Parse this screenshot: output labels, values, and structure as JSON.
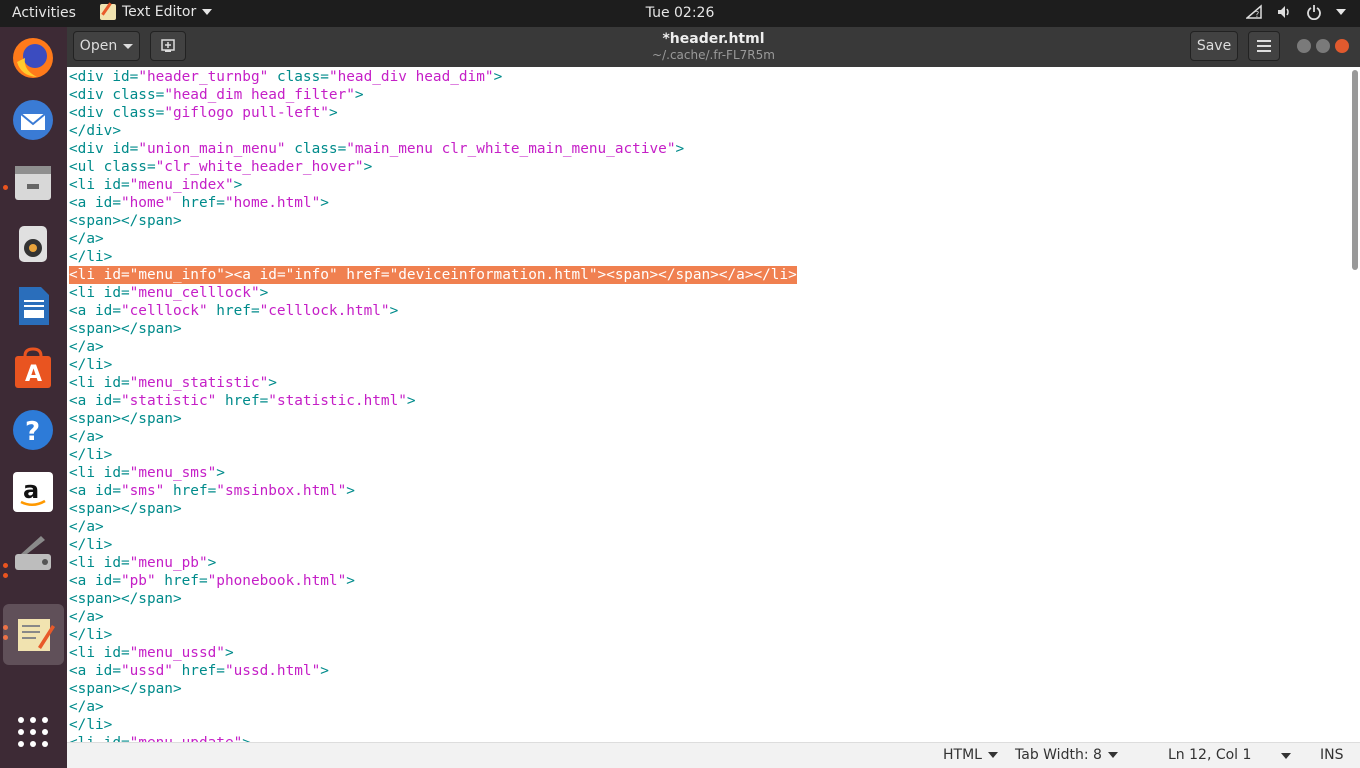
{
  "topbar": {
    "activities": "Activities",
    "app_name": "Text Editor",
    "clock": "Tue 02:26",
    "tray_icons": [
      "network-question-icon",
      "volume-icon",
      "power-icon"
    ]
  },
  "dock": {
    "apps": [
      {
        "name": "firefox",
        "color": "#ff7a1a"
      },
      {
        "name": "thunderbird",
        "color": "#3a7bd5"
      },
      {
        "name": "files",
        "color": "#d8d8d8"
      },
      {
        "name": "rhythmbox",
        "color": "#e0e0e0"
      },
      {
        "name": "libreoffice-writer",
        "color": "#2a6ebb"
      },
      {
        "name": "ubuntu-software",
        "color": "#e95420"
      },
      {
        "name": "help",
        "color": "#2d7bd8"
      },
      {
        "name": "amazon",
        "color": "#ffffff"
      },
      {
        "name": "scanner",
        "color": "#bdbdbd"
      },
      {
        "name": "text-editor",
        "color": "#f1e3b0"
      }
    ]
  },
  "header": {
    "open_label": "Open",
    "title": "*header.html",
    "subtitle": "~/.cache/.fr-FL7R5m",
    "save_label": "Save"
  },
  "editor": {
    "lines": [
      [
        [
          "tag",
          "<div id="
        ],
        [
          "str",
          "\"header_turnbg\""
        ],
        [
          "tag",
          " class="
        ],
        [
          "str",
          "\"head_div head_dim\""
        ],
        [
          "tag",
          ">"
        ]
      ],
      [
        [
          "tag",
          "<div class="
        ],
        [
          "str",
          "\"head_dim head_filter\""
        ],
        [
          "tag",
          ">"
        ]
      ],
      [
        [
          "tag",
          "<div class="
        ],
        [
          "str",
          "\"giflogo pull-left\""
        ],
        [
          "tag",
          ">"
        ]
      ],
      [
        [
          "tag",
          "</div>"
        ]
      ],
      [
        [
          "tag",
          "<div id="
        ],
        [
          "str",
          "\"union_main_menu\""
        ],
        [
          "tag",
          " class="
        ],
        [
          "str",
          "\"main_menu clr_white_main_menu_active\""
        ],
        [
          "tag",
          ">"
        ]
      ],
      [
        [
          "tag",
          "<ul class="
        ],
        [
          "str",
          "\"clr_white_header_hover\""
        ],
        [
          "tag",
          ">"
        ]
      ],
      [
        [
          "tag",
          "<li id="
        ],
        [
          "str",
          "\"menu_index\""
        ],
        [
          "tag",
          ">"
        ]
      ],
      [
        [
          "tag",
          "<a id="
        ],
        [
          "str",
          "\"home\""
        ],
        [
          "tag",
          " href="
        ],
        [
          "str",
          "\"home.html\""
        ],
        [
          "tag",
          ">"
        ]
      ],
      [
        [
          "tag",
          "<span></span>"
        ]
      ],
      [
        [
          "tag",
          "</a>"
        ]
      ],
      [
        [
          "tag",
          "</li>"
        ]
      ],
      [
        [
          "tag",
          "<li id="
        ],
        [
          "str",
          "\"menu_info\""
        ],
        [
          "tag",
          "><a id="
        ],
        [
          "str",
          "\"info\""
        ],
        [
          "tag",
          " href="
        ],
        [
          "str",
          "\"deviceinformation.html\""
        ],
        [
          "tag",
          "><span></span></a></li>"
        ]
      ],
      [
        [
          "tag",
          "<li id="
        ],
        [
          "str",
          "\"menu_celllock\""
        ],
        [
          "tag",
          ">"
        ]
      ],
      [
        [
          "tag",
          "<a id="
        ],
        [
          "str",
          "\"celllock\""
        ],
        [
          "tag",
          " href="
        ],
        [
          "str",
          "\"celllock.html\""
        ],
        [
          "tag",
          ">"
        ]
      ],
      [
        [
          "tag",
          "<span></span>"
        ]
      ],
      [
        [
          "tag",
          "</a>"
        ]
      ],
      [
        [
          "tag",
          "</li>"
        ]
      ],
      [
        [
          "tag",
          "<li id="
        ],
        [
          "str",
          "\"menu_statistic\""
        ],
        [
          "tag",
          ">"
        ]
      ],
      [
        [
          "tag",
          "<a id="
        ],
        [
          "str",
          "\"statistic\""
        ],
        [
          "tag",
          " href="
        ],
        [
          "str",
          "\"statistic.html\""
        ],
        [
          "tag",
          ">"
        ]
      ],
      [
        [
          "tag",
          "<span></span>"
        ]
      ],
      [
        [
          "tag",
          "</a>"
        ]
      ],
      [
        [
          "tag",
          "</li>"
        ]
      ],
      [
        [
          "tag",
          "<li id="
        ],
        [
          "str",
          "\"menu_sms\""
        ],
        [
          "tag",
          ">"
        ]
      ],
      [
        [
          "tag",
          "<a id="
        ],
        [
          "str",
          "\"sms\""
        ],
        [
          "tag",
          " href="
        ],
        [
          "str",
          "\"smsinbox.html\""
        ],
        [
          "tag",
          ">"
        ]
      ],
      [
        [
          "tag",
          "<span></span>"
        ]
      ],
      [
        [
          "tag",
          "</a>"
        ]
      ],
      [
        [
          "tag",
          "</li>"
        ]
      ],
      [
        [
          "tag",
          "<li id="
        ],
        [
          "str",
          "\"menu_pb\""
        ],
        [
          "tag",
          ">"
        ]
      ],
      [
        [
          "tag",
          "<a id="
        ],
        [
          "str",
          "\"pb\""
        ],
        [
          "tag",
          " href="
        ],
        [
          "str",
          "\"phonebook.html\""
        ],
        [
          "tag",
          ">"
        ]
      ],
      [
        [
          "tag",
          "<span></span>"
        ]
      ],
      [
        [
          "tag",
          "</a>"
        ]
      ],
      [
        [
          "tag",
          "</li>"
        ]
      ],
      [
        [
          "tag",
          "<li id="
        ],
        [
          "str",
          "\"menu_ussd\""
        ],
        [
          "tag",
          ">"
        ]
      ],
      [
        [
          "tag",
          "<a id="
        ],
        [
          "str",
          "\"ussd\""
        ],
        [
          "tag",
          " href="
        ],
        [
          "str",
          "\"ussd.html\""
        ],
        [
          "tag",
          ">"
        ]
      ],
      [
        [
          "tag",
          "<span></span>"
        ]
      ],
      [
        [
          "tag",
          "</a>"
        ]
      ],
      [
        [
          "tag",
          "</li>"
        ]
      ],
      [
        [
          "tag",
          "<li id="
        ],
        [
          "str",
          "\"menu_update\""
        ],
        [
          "tag",
          ">"
        ]
      ]
    ],
    "selected_line": 12
  },
  "statusbar": {
    "language": "HTML",
    "tab_width": "Tab Width: 8",
    "position": "Ln 12, Col 1",
    "mode": "INS"
  }
}
